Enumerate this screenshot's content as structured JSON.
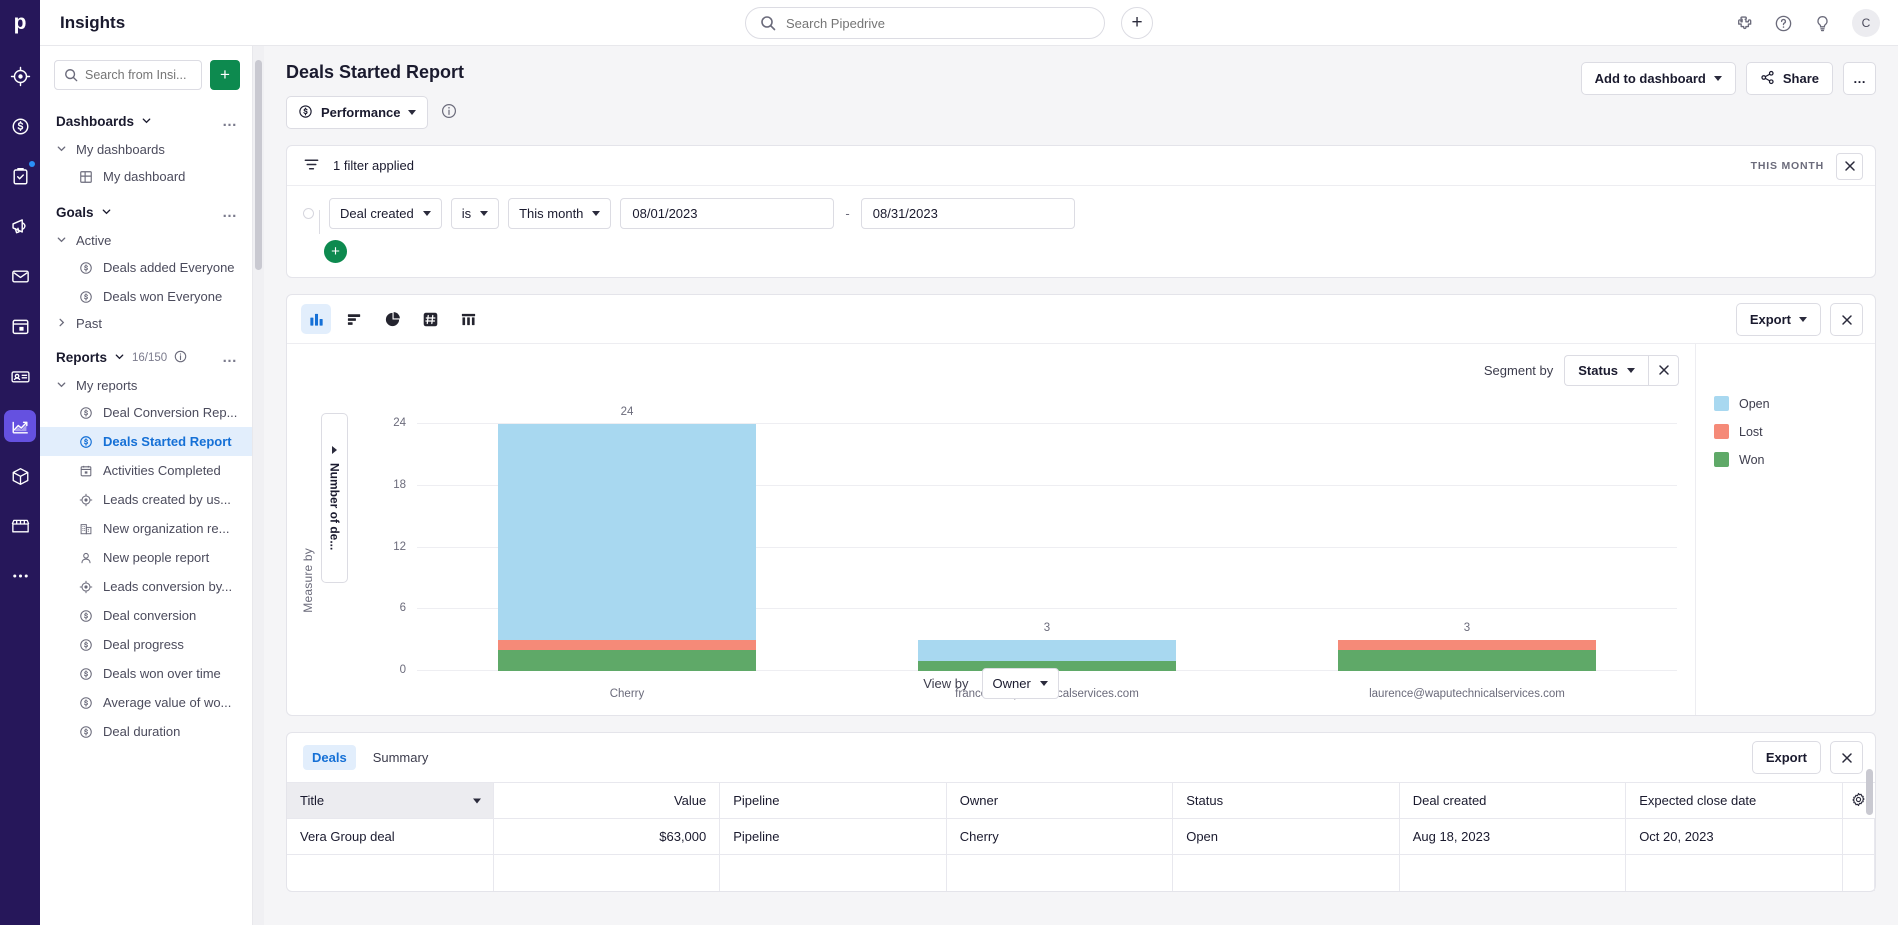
{
  "topbar": {
    "logo": "p",
    "title": "Insights",
    "search_placeholder": "Search Pipedrive",
    "search_value": "",
    "add_label": "+",
    "avatar_initial": "C",
    "icons": [
      "puzzle-icon",
      "help-icon",
      "lightbulb-icon"
    ]
  },
  "rail": {
    "items": [
      {
        "name": "leads-icon"
      },
      {
        "name": "deals-icon"
      },
      {
        "name": "activities-icon",
        "badge": true
      },
      {
        "name": "campaigns-icon"
      },
      {
        "name": "mail-icon"
      },
      {
        "name": "calendar-icon"
      },
      {
        "name": "contacts-icon"
      },
      {
        "name": "insights-icon",
        "active": true
      },
      {
        "name": "products-icon"
      },
      {
        "name": "marketplace-icon"
      },
      {
        "name": "more-icon"
      }
    ]
  },
  "sidebar": {
    "search_placeholder": "Search from Insi...",
    "search_value": "",
    "add_label": "+",
    "sections": [
      {
        "label": "Dashboards",
        "more": "…",
        "groups": [
          {
            "label": "My dashboards",
            "items": [
              {
                "label": "My dashboard",
                "icon": "dashboard-icon"
              }
            ]
          }
        ]
      },
      {
        "label": "Goals",
        "more": "…",
        "groups": [
          {
            "label": "Active",
            "items": [
              {
                "label": "Deals added Everyone",
                "icon": "deal-icon"
              },
              {
                "label": "Deals won Everyone",
                "icon": "deal-icon"
              }
            ]
          },
          {
            "label": "Past",
            "collapsed": true,
            "items": []
          }
        ]
      },
      {
        "label": "Reports",
        "count": "16/150",
        "more": "…",
        "groups": [
          {
            "label": "My reports",
            "items": [
              {
                "label": "Deal Conversion Rep...",
                "icon": "deal-icon"
              },
              {
                "label": "Deals Started Report",
                "icon": "deal-icon",
                "active": true
              },
              {
                "label": "Activities Completed",
                "icon": "calendar-icon"
              },
              {
                "label": "Leads created by us...",
                "icon": "lead-icon"
              },
              {
                "label": "New organization re...",
                "icon": "org-icon"
              },
              {
                "label": "New people report",
                "icon": "person-icon"
              },
              {
                "label": "Leads conversion by...",
                "icon": "lead-icon"
              },
              {
                "label": "Deal conversion",
                "icon": "deal-icon"
              },
              {
                "label": "Deal progress",
                "icon": "deal-icon"
              },
              {
                "label": "Deals won over time",
                "icon": "deal-icon"
              },
              {
                "label": "Average value of wo...",
                "icon": "deal-icon"
              },
              {
                "label": "Deal duration",
                "icon": "deal-icon"
              }
            ]
          }
        ]
      }
    ]
  },
  "report": {
    "title": "Deals Started Report",
    "type_label": "Performance",
    "info_icon": "info-icon",
    "add_to_dashboard": "Add to dashboard",
    "share": "Share",
    "more": "…"
  },
  "filters": {
    "summary": "1 filter applied",
    "period_badge": "THIS MONTH",
    "close": "✕",
    "field": "Deal created",
    "operator": "is",
    "period": "This month",
    "date_from": "08/01/2023",
    "date_to": "08/31/2023",
    "separator": "-",
    "add_label": "+"
  },
  "chart": {
    "types": [
      {
        "name": "bar-chart-icon",
        "active": true
      },
      {
        "name": "horizontal-bar-chart-icon",
        "active": false
      },
      {
        "name": "pie-chart-icon",
        "active": false
      },
      {
        "name": "number-icon",
        "active": false
      },
      {
        "name": "table-icon",
        "active": false
      }
    ],
    "export_label": "Export",
    "close": "✕",
    "segment_by_label": "Segment by",
    "segment_by_value": "Status",
    "segment_close": "✕",
    "view_by_label": "View by",
    "view_by_value": "Owner",
    "measure_by_label": "Measure by",
    "measure_value": "Number of de..."
  },
  "chart_data": {
    "type": "bar",
    "subtype": "stacked",
    "title": "",
    "xlabel": "Owner",
    "ylabel": "Number of deals",
    "ylim": [
      0,
      24
    ],
    "yticks": [
      0,
      6,
      12,
      18,
      24
    ],
    "grid": true,
    "legend_position": "right",
    "categories": [
      "Cherry",
      "franco@waputechnicalservices.com",
      "laurence@waputechnicalservices.com"
    ],
    "totals": [
      24,
      3,
      3
    ],
    "series": [
      {
        "name": "Open",
        "color": "#a8d8f0",
        "values": [
          21,
          2,
          0
        ]
      },
      {
        "name": "Lost",
        "color": "#f58a78",
        "values": [
          1,
          0,
          1
        ]
      },
      {
        "name": "Won",
        "color": "#5fa968",
        "values": [
          2,
          1,
          2
        ]
      }
    ]
  },
  "table": {
    "tabs": [
      {
        "label": "Deals",
        "active": true
      },
      {
        "label": "Summary",
        "active": false
      }
    ],
    "export_label": "Export",
    "close": "✕",
    "settings_icon": "gear-icon",
    "columns": [
      {
        "label": "Title",
        "sorted": true,
        "align": "left"
      },
      {
        "label": "Value",
        "align": "right"
      },
      {
        "label": "Pipeline",
        "align": "left"
      },
      {
        "label": "Owner",
        "align": "left"
      },
      {
        "label": "Status",
        "align": "left"
      },
      {
        "label": "Deal created",
        "align": "left"
      },
      {
        "label": "Expected close date",
        "align": "left"
      }
    ],
    "rows": [
      [
        "Vera Group deal",
        "$63,000",
        "Pipeline",
        "Cherry",
        "Open",
        "Aug 18, 2023",
        "Oct 20, 2023"
      ]
    ]
  },
  "colors": {
    "brand": "#26175a",
    "accent": "#1570d6",
    "green": "#0d8a4f",
    "open": "#a8d8f0",
    "lost": "#f58a78",
    "won": "#5fa968"
  }
}
